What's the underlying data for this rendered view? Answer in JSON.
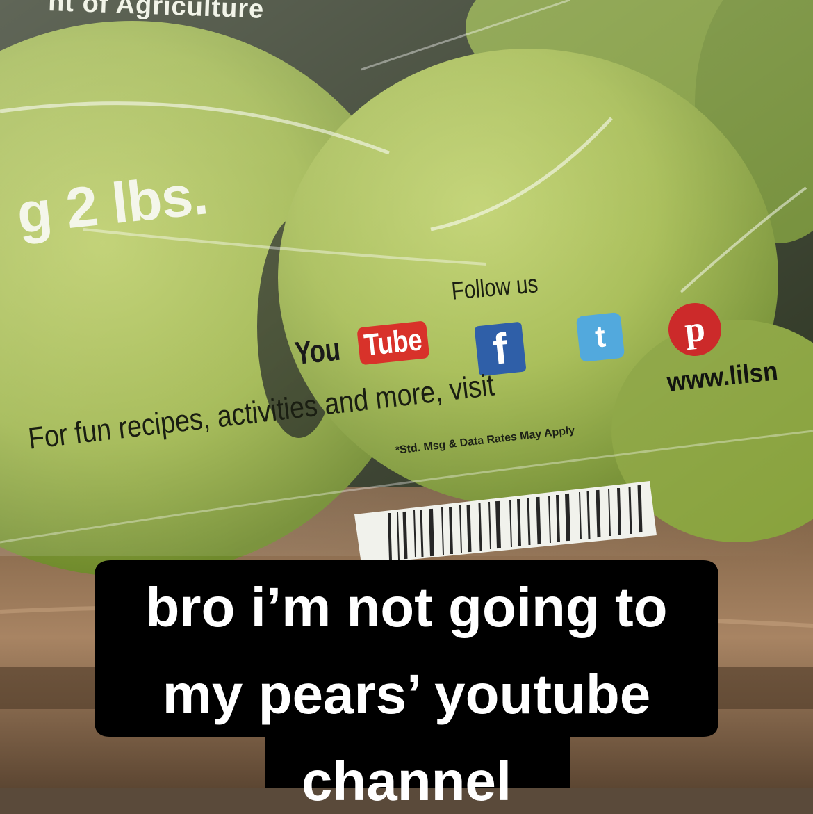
{
  "package_print": {
    "agency": "nt of Agriculture",
    "weight": "g 2 lbs.",
    "follow_label": "Follow us",
    "youtube_you": "You",
    "youtube_tube": "Tube",
    "facebook_glyph": "f",
    "twitter_glyph": "t",
    "pinterest_glyph": "p",
    "promo_line": "For fun recipes, activities and more, visit",
    "website": "www.lilsn",
    "disclaimer": "*Std. Msg & Data Rates May Apply"
  },
  "caption": {
    "line1": "bro i’m not going to",
    "line2": "my pears’ youtube",
    "line3": "channel"
  },
  "colors": {
    "pear_green": "#9db548",
    "caption_bg": "#000000",
    "caption_text": "#ffffff",
    "youtube_red": "#d8322a",
    "facebook_blue": "#2f5fa8",
    "twitter_blue": "#52a9dd",
    "pinterest_red": "#cc2a2a"
  },
  "icons": [
    "youtube-logo",
    "facebook-icon",
    "twitter-icon",
    "pinterest-icon",
    "barcode"
  ]
}
